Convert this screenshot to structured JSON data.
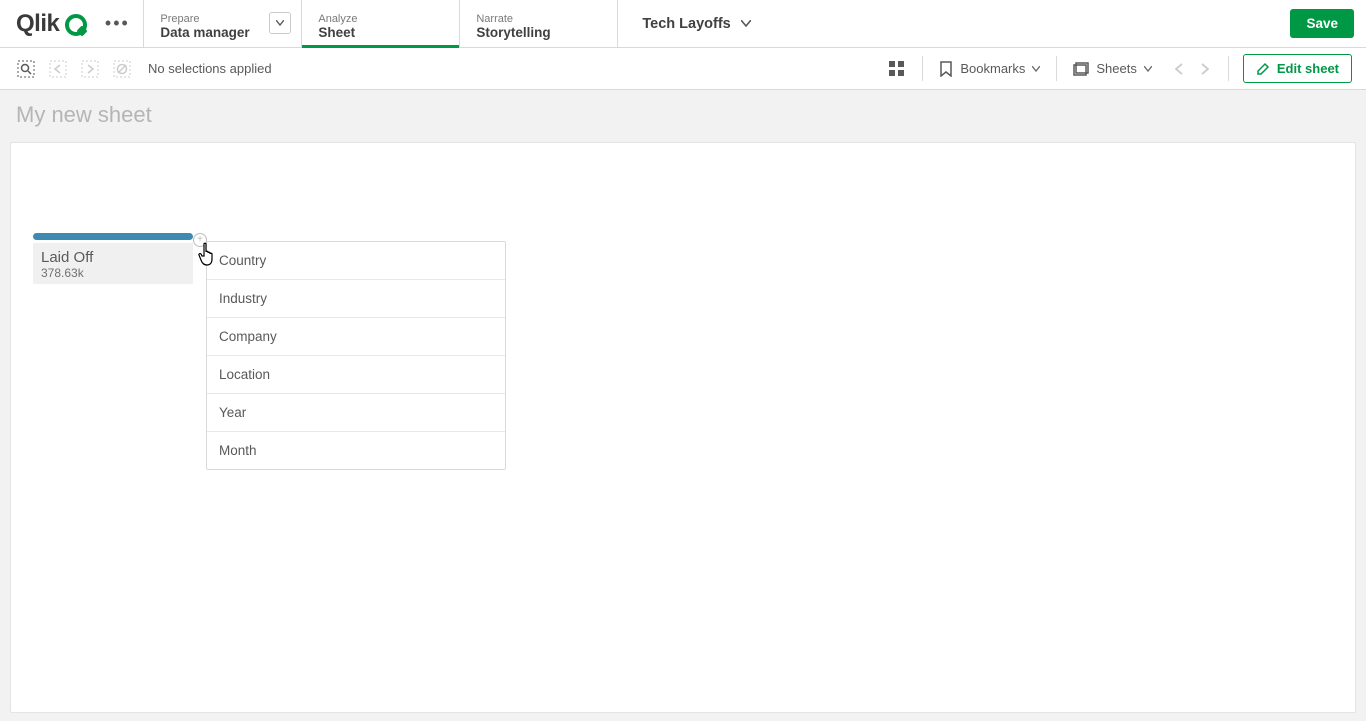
{
  "brand": "Qlik",
  "app_title": "Tech Layoffs",
  "nav": {
    "prepare": {
      "small": "Prepare",
      "big": "Data manager"
    },
    "analyze": {
      "small": "Analyze",
      "big": "Sheet"
    },
    "narrate": {
      "small": "Narrate",
      "big": "Storytelling"
    }
  },
  "save_label": "Save",
  "selections_text": "No selections applied",
  "tools": {
    "bookmarks": "Bookmarks",
    "sheets": "Sheets",
    "edit_sheet": "Edit sheet"
  },
  "sheet_title": "My new sheet",
  "kpi": {
    "label": "Laid Off",
    "value": "378.63k"
  },
  "context_menu": [
    "Country",
    "Industry",
    "Company",
    "Location",
    "Year",
    "Month"
  ]
}
